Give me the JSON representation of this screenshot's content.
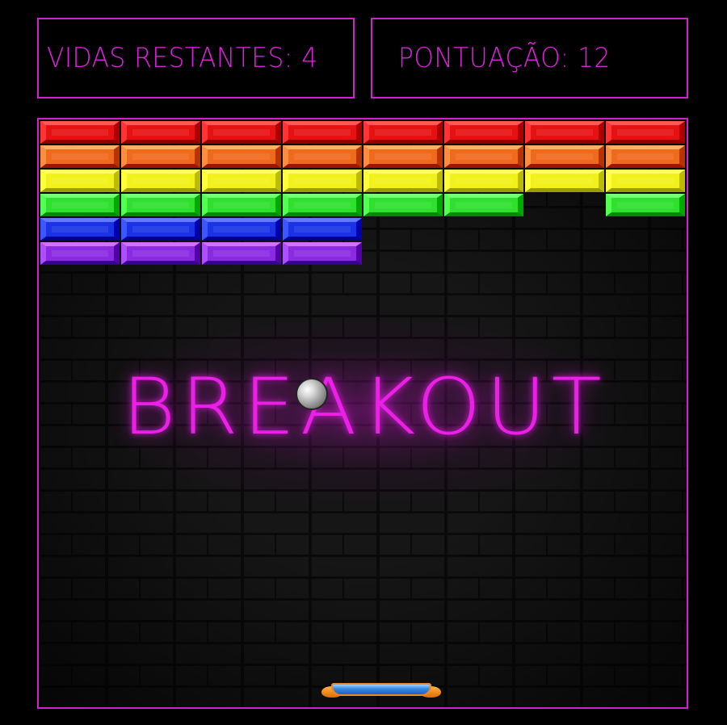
{
  "hud": {
    "lives_text": "VIDAS RESTANTES: 4",
    "score_text": "PONTUAÇÃO: 12"
  },
  "game": {
    "title": "BREAKOUT",
    "colors": {
      "neon": "#e01fe0",
      "red": "#e61212",
      "orange": "#f06a1e",
      "yellow": "#f2f21a",
      "green": "#2fe02f",
      "blue": "#1a33e6",
      "purple": "#8a2be2",
      "paddle_blue": "#3a8be6",
      "paddle_orange": "#f08a18"
    },
    "bricks": {
      "columns": 8,
      "rows": [
        {
          "color": "red",
          "present": [
            true,
            true,
            true,
            true,
            true,
            true,
            true,
            true
          ]
        },
        {
          "color": "orange",
          "present": [
            true,
            true,
            true,
            true,
            true,
            true,
            true,
            true
          ]
        },
        {
          "color": "yellow",
          "present": [
            true,
            true,
            true,
            true,
            true,
            true,
            true,
            true
          ]
        },
        {
          "color": "green",
          "present": [
            true,
            true,
            true,
            true,
            true,
            true,
            false,
            true
          ]
        },
        {
          "color": "blue",
          "present": [
            true,
            true,
            true,
            true,
            false,
            false,
            false,
            false
          ]
        },
        {
          "color": "purple",
          "present": [
            true,
            true,
            true,
            true,
            false,
            false,
            false,
            false
          ]
        }
      ]
    }
  }
}
